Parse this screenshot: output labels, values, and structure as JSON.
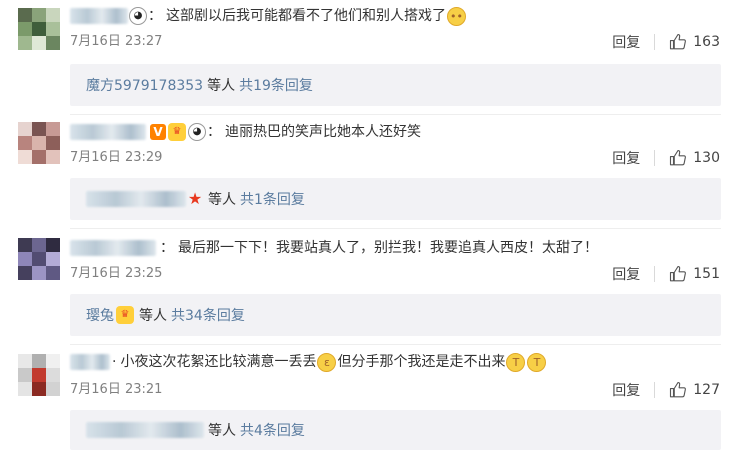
{
  "comments": [
    {
      "name_visible": "",
      "text": "这部剧以后我可能都看不了他们和别人搭戏了",
      "date": "7月16日 23:27",
      "reply_label": "回复",
      "likes": "163",
      "reply_preview": {
        "user": "魔方5979178353",
        "middle": "等人",
        "total": "共19条回复"
      }
    },
    {
      "name_visible": "",
      "text": "迪丽热巴的笑声比她本人还好笑",
      "date": "7月16日 23:29",
      "reply_label": "回复",
      "likes": "130",
      "reply_preview": {
        "user": "",
        "middle": "等人",
        "total": "共1条回复"
      }
    },
    {
      "name_visible": "",
      "text": "最后那一下下！我要站真人了，别拦我！我要追真人西皮！太甜了！",
      "date": "7月16日 23:25",
      "reply_label": "回复",
      "likes": "151",
      "reply_preview": {
        "user": "璎兔",
        "middle": "等人",
        "total": "共34条回复"
      }
    },
    {
      "name_visible": "",
      "text_a": "小夜这次花絮还比较满意一丢丢",
      "text_b": "但分手那个我还是走不出来",
      "date": "7月16日 23:21",
      "reply_label": "回复",
      "likes": "127",
      "reply_preview": {
        "user": "",
        "middle": "等人",
        "total": "共4条回复"
      }
    }
  ],
  "colors": {
    "link": "#5b7c9f",
    "meta": "#808080",
    "reply_bg": "#f2f2f5"
  },
  "icons": {
    "like": "thumbs-up-icon",
    "panda": "panda-emoji-icon",
    "pleading": "pleading-face-icon",
    "vip": "vip-badge-icon",
    "crown": "crown-badge-icon",
    "star": "star-icon",
    "kiss": "kissing-face-icon",
    "cry": "crying-face-icon"
  }
}
